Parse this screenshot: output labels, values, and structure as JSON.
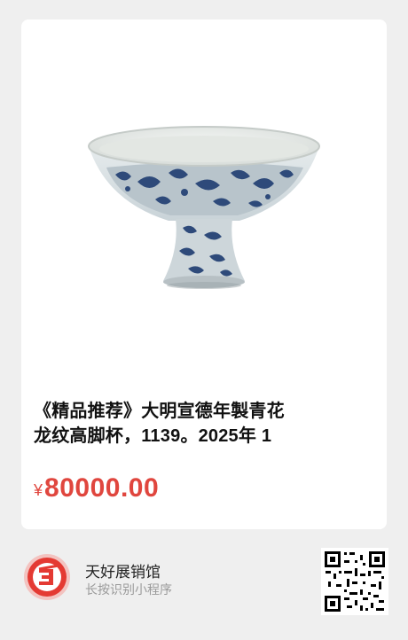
{
  "product": {
    "title_line1": "《精品推荐》大明宣德年製青花",
    "title_line2": "龙纹高脚杯，1139。2025年 1",
    "currency": "¥",
    "price": "80000.00"
  },
  "footer": {
    "shop_name": "天好展销馆",
    "hint": "长按识别小程序"
  },
  "colors": {
    "price": "#e0463e",
    "logo_red": "#e43a33",
    "background": "#efefef"
  },
  "icons": {
    "logo": "shop-logo-icon",
    "qr": "qr-code-icon"
  }
}
